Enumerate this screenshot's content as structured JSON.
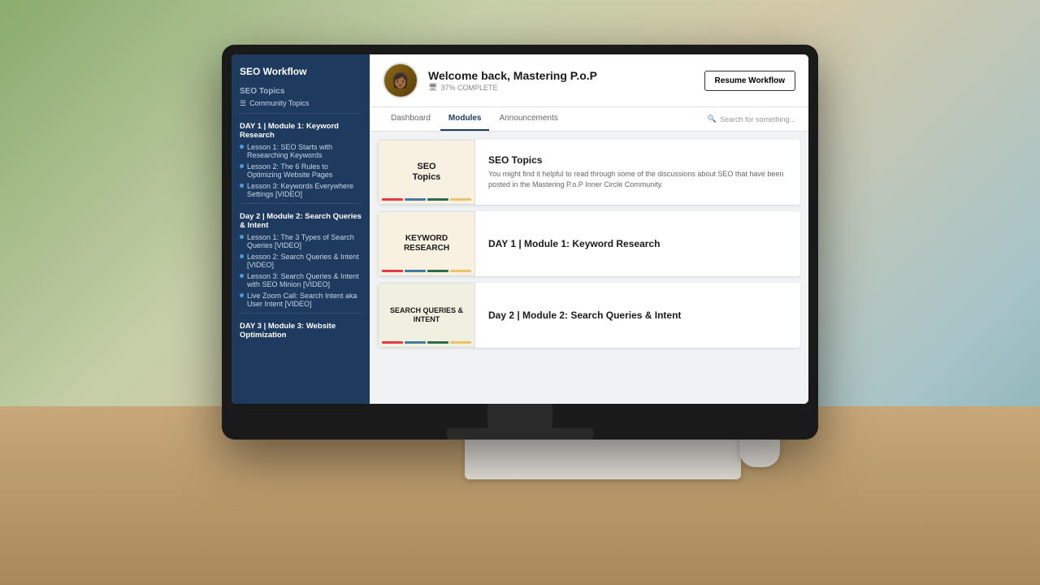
{
  "app": {
    "sidebar": {
      "title": "SEO Workflow",
      "sections": [
        {
          "label": "SEO Topics",
          "items": [
            {
              "text": "Community Topics",
              "type": "link",
              "indent": 1
            }
          ]
        },
        {
          "label": "DAY 1 | Module 1: Keyword Research",
          "type": "module-header",
          "items": [
            {
              "text": "Lesson 1: SEO Starts with Researching Keywords",
              "type": "lesson"
            },
            {
              "text": "Lesson 2: The 6 Rules to Optimizing Website Pages",
              "type": "lesson"
            },
            {
              "text": "Lesson 3: Keywords Everywhere Settings [VIDEO]",
              "type": "lesson",
              "active": true
            }
          ]
        },
        {
          "label": "Day 2 | Module 2: Search Queries & Intent",
          "type": "module-header",
          "items": [
            {
              "text": "Lesson 1: The 3 Types of Search Queries [VIDEO]",
              "type": "lesson"
            },
            {
              "text": "Lesson 2: Search Queries & Intent [VIDEO]",
              "type": "lesson"
            },
            {
              "text": "Lesson 3: Search Queries & Intent with SEO Minion [VIDEO]",
              "type": "lesson"
            },
            {
              "text": "Live Zoom Call: Search Intent aka User Intent [VIDEO]",
              "type": "lesson"
            }
          ]
        },
        {
          "label": "DAY 3 | Module 3: Website Optimization",
          "type": "module-header",
          "items": []
        }
      ]
    },
    "header": {
      "welcome": "Welcome back, Mastering P.o.P",
      "progress": "37% COMPLETE",
      "resume_btn": "Resume Workflow"
    },
    "tabs": [
      {
        "label": "Dashboard",
        "active": false
      },
      {
        "label": "Modules",
        "active": true
      },
      {
        "label": "Announcements",
        "active": false
      }
    ],
    "search": {
      "placeholder": "Search for something..."
    },
    "modules": [
      {
        "id": "seo-topics",
        "thumb_text": "SEO\nTopics",
        "thumb_type": "seo",
        "title": "SEO Topics",
        "description": "You might find it helpful to read through some of the discussions about SEO that have been posted in the Mastering P.o.P Inner Circle Community."
      },
      {
        "id": "keyword-research",
        "thumb_text": "KEYWORD\nRESEARCH",
        "thumb_type": "keyword",
        "title": "DAY 1 | Module 1: Keyword Research",
        "description": ""
      },
      {
        "id": "search-queries",
        "thumb_text": "SEARCH QUERIES &\nINTENT",
        "thumb_type": "search",
        "title": "Day 2 | Module 2: Search Queries & Intent",
        "description": ""
      }
    ],
    "thumb_colors": {
      "line1": "#e63946",
      "line2": "#457b9d",
      "line3": "#2d6a4f",
      "line4": "#e9c46a"
    }
  }
}
